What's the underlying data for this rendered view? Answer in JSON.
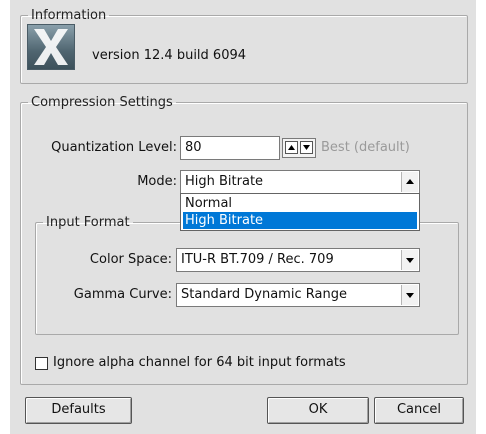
{
  "information": {
    "legend": "Information",
    "version_text": "version 12.4 build 6094"
  },
  "compression": {
    "legend": "Compression Settings",
    "quantization_label": "Quantization Level:",
    "quantization_value": "80",
    "quantization_hint": "Best (default)",
    "mode_label": "Mode:",
    "mode_value": "High Bitrate",
    "mode_options": [
      "Normal",
      "High Bitrate"
    ]
  },
  "input_format": {
    "legend": "Input Format",
    "color_space_label": "Color Space:",
    "color_space_value": "ITU-R BT.709 / Rec. 709",
    "gamma_label": "Gamma Curve:",
    "gamma_value": "Standard Dynamic Range"
  },
  "ignore_alpha_label": "Ignore alpha channel for 64 bit input formats",
  "buttons": {
    "defaults": "Defaults",
    "ok": "OK",
    "cancel": "Cancel"
  },
  "colors": {
    "dialog_bg": "#e1e1e1",
    "selection": "#0078d7"
  }
}
